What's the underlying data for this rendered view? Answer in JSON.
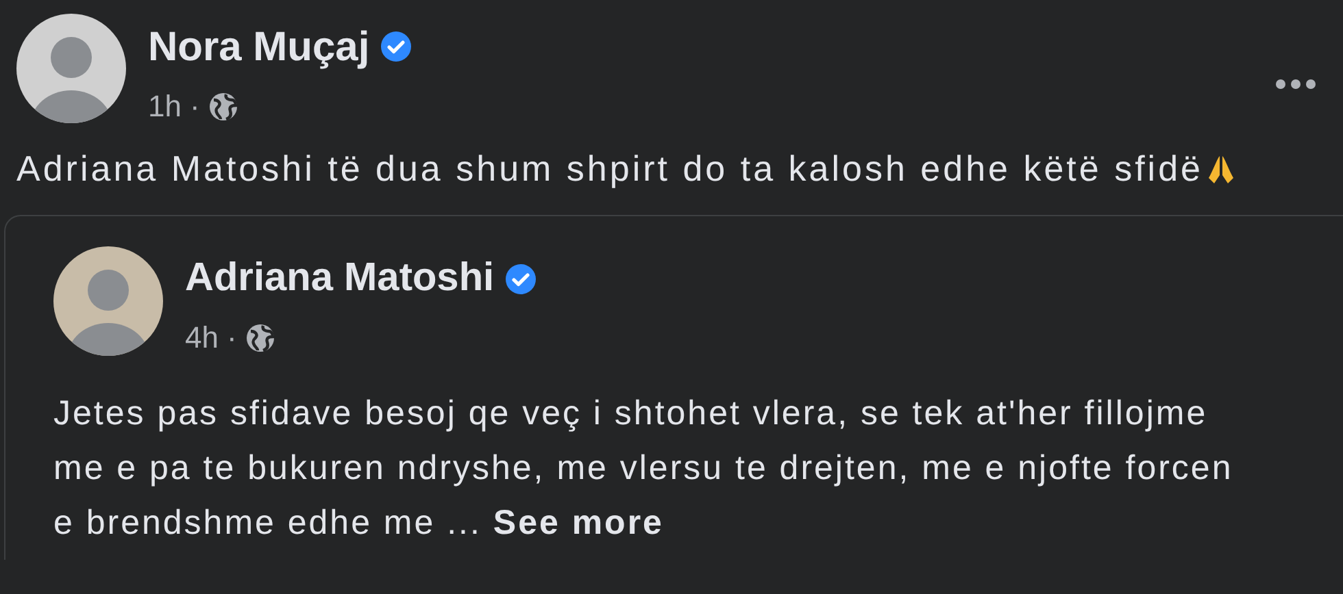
{
  "post": {
    "author": {
      "name": "Nora Muçaj",
      "verified": true
    },
    "time": "1h",
    "separator": "·",
    "public": true,
    "text": "Adriana Matoshi të dua shum shpirt do ta kalosh edhe këtë sfidë",
    "shared_post": {
      "author": {
        "name": "Adriana Matoshi",
        "verified": true
      },
      "time": "4h",
      "separator": "·",
      "public": true,
      "text": "Jetes pas sfidave besoj qe veç i shtohet vlera, se tek at'her fillojme me e pa te bukuren ndryshe, me vlersu te drejten, me e njofte forcen e brendshme edhe me ...",
      "see_more": "See more"
    }
  }
}
